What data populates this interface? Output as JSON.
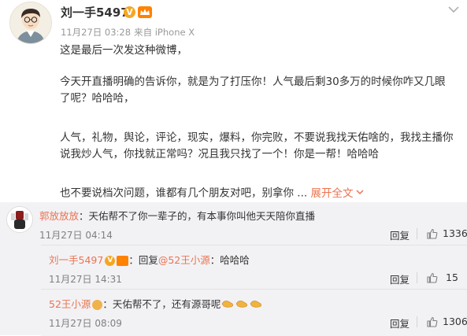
{
  "post": {
    "author": "刘一手5497",
    "verified_icon": "verified-v-icon",
    "vip_icon": "vip-crown-icon",
    "date": "11月27日 03:28",
    "source": "来自 iPhone X",
    "paragraphs": [
      "这是最后一次发这种微博，",
      "今天开直播明确的告诉你，就是为了打压你！人气最后剩30多万的时候你咋又几眼了呢？哈哈哈，",
      "人气，礼物，舆论，评论，现实，爆料，你完败，不要说我找天佑啥的，我找主播你说我炒人气，你找就正常吗？况且我只找了一个！你是一帮！哈哈哈",
      "也不要说档次问题，谁都有几个朋友对吧，别拿你 ..."
    ],
    "expand_label": "展开全文",
    "expand_icon": "chevron-down-icon"
  },
  "comments": [
    {
      "author": "郭放放放",
      "text": "：天佑帮不了你一辈子的，有本事你叫他天天陪你直播",
      "time": "11月27日 04:14",
      "reply_label": "回复",
      "likes": "1336"
    }
  ],
  "replies": [
    {
      "author": "刘一手5497",
      "reply_prefix": "：回复",
      "mention": "@52王小源",
      "text": "：哈哈哈",
      "time": "11月27日 14:31",
      "reply_label": "回复",
      "likes": "15"
    },
    {
      "author": "52王小源",
      "text": "：天佑帮不了，还有源哥呢",
      "emoji_icon": "handshake-emoji-icon",
      "time": "11月27日 08:09",
      "reply_label": "回复",
      "likes": "1306"
    }
  ],
  "colors": {
    "link": "#eb7350",
    "muted": "#999999",
    "panel": "#f2f2f5",
    "verified": "#f5a623",
    "vip": "#ff8200"
  }
}
